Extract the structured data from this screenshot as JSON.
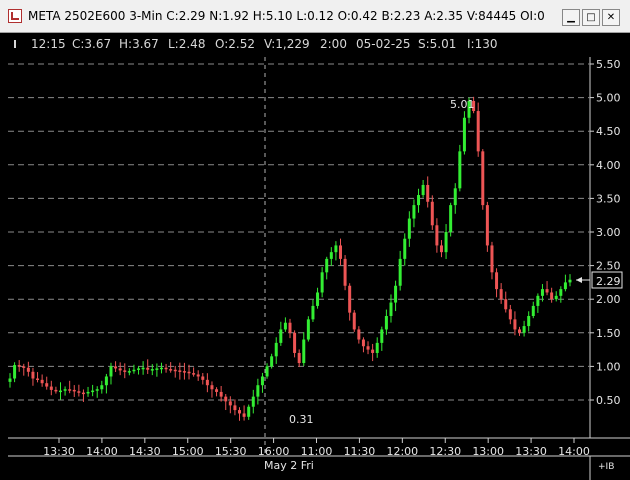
{
  "window": {
    "title": "META 2502E600 3-Min C:2.29 N:1.92 H:5.10 L:0.12 O:0.42 B:2.23 A:2.35 V:84445 OI:0",
    "minimize_glyph": "▁",
    "maximize_glyph": "□",
    "close_glyph": "✕"
  },
  "status": {
    "time": "12:15",
    "close": "C:3.67",
    "high": "H:3.67",
    "low": "L:2.48",
    "open": "O:2.52",
    "volume": "V:1,229",
    "interval": "2:00",
    "date": "05-02-25",
    "strike": "S:5.01",
    "iv": "I:130"
  },
  "chart_data": {
    "type": "candlestick",
    "y_ticks": [
      "5.50",
      "5.00",
      "4.50",
      "4.00",
      "3.50",
      "3.00",
      "2.50",
      "2.00",
      "1.50",
      "1.00",
      "0.50"
    ],
    "ylim": [
      0.1,
      5.6
    ],
    "x_ticks": [
      "13:30",
      "14:00",
      "14:30",
      "15:00",
      "15:30",
      "16:00",
      "11:00",
      "11:30",
      "12:00",
      "12:30",
      "13:00",
      "13:30",
      "14:00"
    ],
    "date_label": "May 2 Fri",
    "session_break_label": "16:00",
    "annotations": {
      "high_label": "5.01",
      "low_label": "0.31",
      "last_price_label": "2.29"
    },
    "corner_label": "+IB",
    "colors": {
      "up": "#33ee33",
      "down": "#ee5555",
      "grid": "#8a8a8a",
      "background": "#000000"
    },
    "series": [
      {
        "values": [
          0.82,
          1.02,
          1.0,
          0.98,
          0.92,
          0.82,
          0.8,
          0.75,
          0.7,
          0.65,
          0.63,
          0.64,
          0.66,
          0.65,
          0.63,
          0.61,
          0.6,
          0.62,
          0.64,
          0.66,
          0.72,
          0.85,
          1.0,
          0.97,
          0.94,
          0.92,
          0.93,
          0.95,
          0.97,
          0.98,
          0.95,
          0.96,
          0.97,
          0.98,
          0.96,
          0.95,
          0.94,
          0.93,
          0.92,
          0.9,
          0.88,
          0.85,
          0.8,
          0.72,
          0.66,
          0.62,
          0.55,
          0.48,
          0.42,
          0.35,
          0.3,
          0.25,
          0.4,
          0.55,
          0.72,
          0.85,
          1.0,
          1.15,
          1.35,
          1.55,
          1.65,
          1.5,
          1.2,
          1.05,
          1.4,
          1.7,
          1.9,
          2.1,
          2.4,
          2.6,
          2.7,
          2.8,
          2.6,
          2.2,
          1.8,
          1.55,
          1.4,
          1.3,
          1.25,
          1.2,
          1.35,
          1.55,
          1.75,
          1.95,
          2.2,
          2.6,
          2.9,
          3.2,
          3.4,
          3.55,
          3.7,
          3.45,
          3.1,
          2.8,
          2.7,
          3.0,
          3.4,
          3.65,
          4.2,
          4.7,
          4.95,
          4.8,
          4.2,
          3.4,
          2.8,
          2.4,
          2.15,
          2.0,
          1.85,
          1.7,
          1.55,
          1.5,
          1.6,
          1.75,
          1.9,
          2.05,
          2.15,
          2.1,
          2.0,
          2.05,
          2.15,
          2.25,
          2.29
        ]
      }
    ]
  }
}
